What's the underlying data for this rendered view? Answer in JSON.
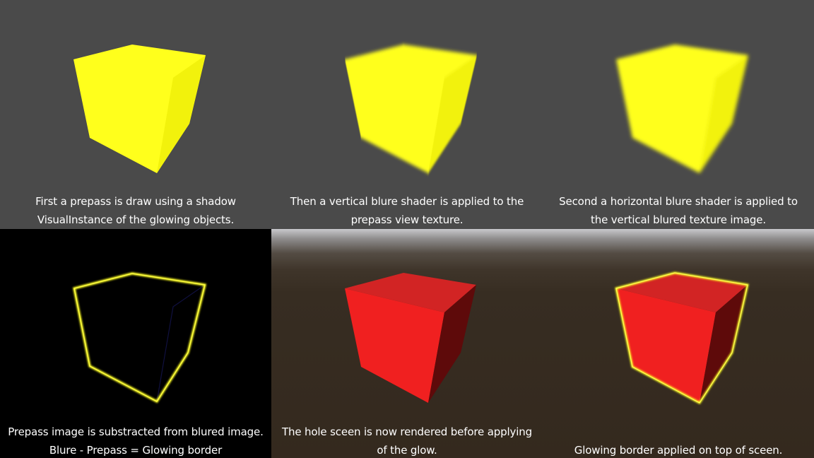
{
  "panels": [
    {
      "caption": [
        "First a prepass is draw using a shadow",
        "VisualInstance of the glowing objects."
      ],
      "style": "yellow cube, sharp edges",
      "background": "#4a4a4a"
    },
    {
      "caption": [
        "Then a vertical blure shader is applied to the",
        "prepass view texture."
      ],
      "style": "yellow cube, vertically blurred edges",
      "background": "#4a4a4a"
    },
    {
      "caption": [
        "Second a horizontal blure shader is applied to",
        "the vertical blured texture image."
      ],
      "style": "yellow cube, fully blurred edges",
      "background": "#4a4a4a"
    },
    {
      "caption": [
        "Prepass image is substracted from blured image.",
        "Blure - Prepass = Glowing border"
      ],
      "style": "black cube with yellow glowing outline",
      "background": "#000000"
    },
    {
      "caption": [
        "The hole sceen is now rendered before applying",
        "of the glow."
      ],
      "style": "red cube in scene",
      "background": "#34291e"
    },
    {
      "caption": [
        "",
        "Glowing border applied on top of sceen."
      ],
      "style": "red cube with yellow glowing border in scene",
      "background": "#34291e"
    }
  ],
  "colors": {
    "glow_yellow": "#ffff18",
    "cube_red_front": "#f02020",
    "cube_red_top": "#d42424",
    "cube_red_side": "#5e0a0a",
    "caption_text": "#ffffff"
  }
}
